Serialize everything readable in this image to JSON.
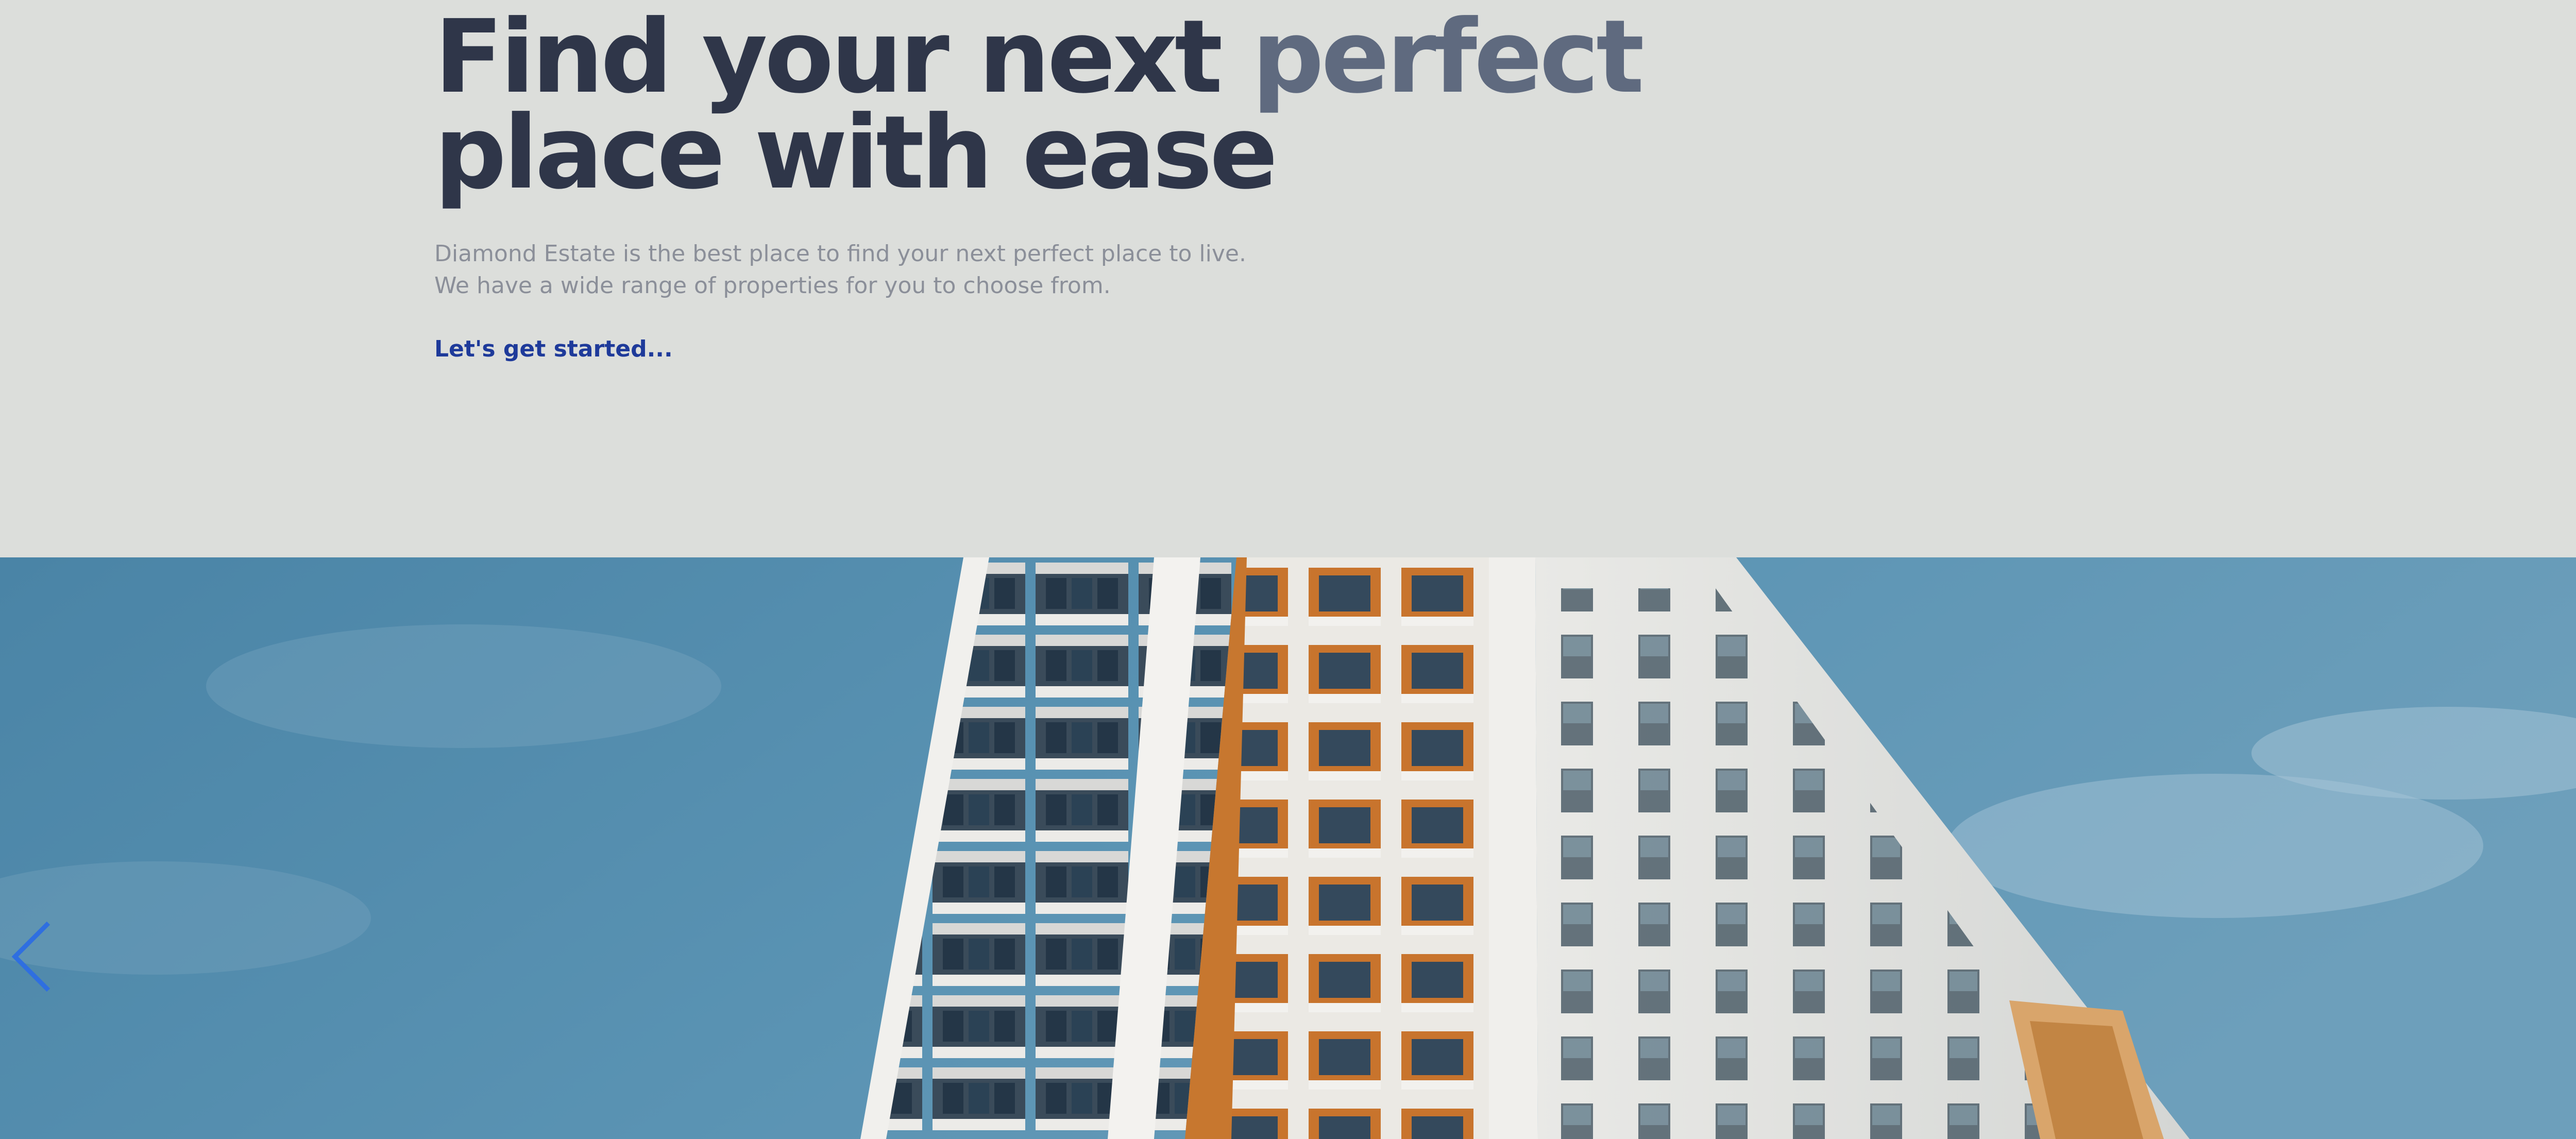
{
  "hero": {
    "headline_part1": "Find your next ",
    "headline_accent": "perfect",
    "headline_line2": "place with ease",
    "subtext_line1": "Diamond Estate is the best place to find your next perfect place to live.",
    "subtext_line2": "We have a wide range of properties for you to choose from.",
    "cta_label": "Let's get started..."
  },
  "carousel": {
    "image_subject": "apartment-building-photo",
    "prev_icon": "chevron-left-icon",
    "next_icon": "chevron-right-icon"
  },
  "colors": {
    "background": "#dcdedb",
    "headline": "#2f3649",
    "accent": "#5f6a7f",
    "body_text": "#8b8f99",
    "cta": "#1e3a9a",
    "arrow": "#2f6fe0"
  }
}
